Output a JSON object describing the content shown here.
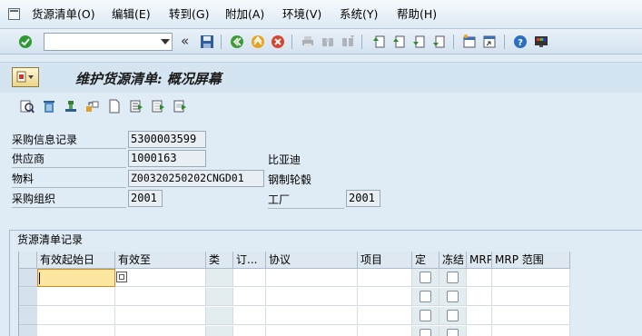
{
  "menu": {
    "items": [
      "货源清单(O)",
      "编辑(E)",
      "转到(G)",
      "附加(A)",
      "环境(V)",
      "系统(Y)",
      "帮助(H)"
    ]
  },
  "toolbar": {
    "command_value": "",
    "overflow_glyph": "«",
    "icons": [
      "enter-check-icon",
      "save-icon",
      "back-icon",
      "exit-icon",
      "cancel-icon",
      "print-icon",
      "find-icon",
      "find-next-icon",
      "first-page-icon",
      "previous-page-icon",
      "next-page-icon",
      "last-page-icon",
      "create-session-icon",
      "shortcut-icon",
      "help-icon",
      "customize-layout-icon"
    ]
  },
  "title": {
    "text": "维护货源清单: 概况屏幕"
  },
  "app_toolbar": {
    "icons": [
      "detail-icon",
      "delete-icon",
      "fix-icon",
      "generate-icon",
      "new-entry-icon",
      "select-all-icon",
      "deselect-icon",
      "select-block-icon"
    ]
  },
  "form": {
    "info_record_label": "采购信息记录",
    "info_record_value": "5300003599",
    "vendor_label": "供应商",
    "vendor_value": "1000163",
    "vendor_name": "比亚迪",
    "material_label": "物料",
    "material_value": "Z00320250202CNGD01",
    "material_desc": "钢制轮毂",
    "purch_org_label": "采购组织",
    "purch_org_value": "2001",
    "plant_label": "工厂",
    "plant_value": "2001"
  },
  "group": {
    "title": "货源清单记录"
  },
  "table": {
    "columns": [
      "有效起始日",
      "有效至",
      "类",
      "订...",
      "协议",
      "项目",
      "定",
      "冻结",
      "MRP",
      "MRP 范围"
    ],
    "rows": [
      {
        "valid_from": "",
        "valid_to": ""
      },
      {
        "valid_from": "",
        "valid_to": ""
      },
      {
        "valid_from": "",
        "valid_to": ""
      },
      {
        "valid_from": "",
        "valid_to": ""
      }
    ]
  },
  "colors": {
    "background": "#dfebf5",
    "input_focus": "#fbe7a0",
    "table_header": "#dee8f1"
  }
}
